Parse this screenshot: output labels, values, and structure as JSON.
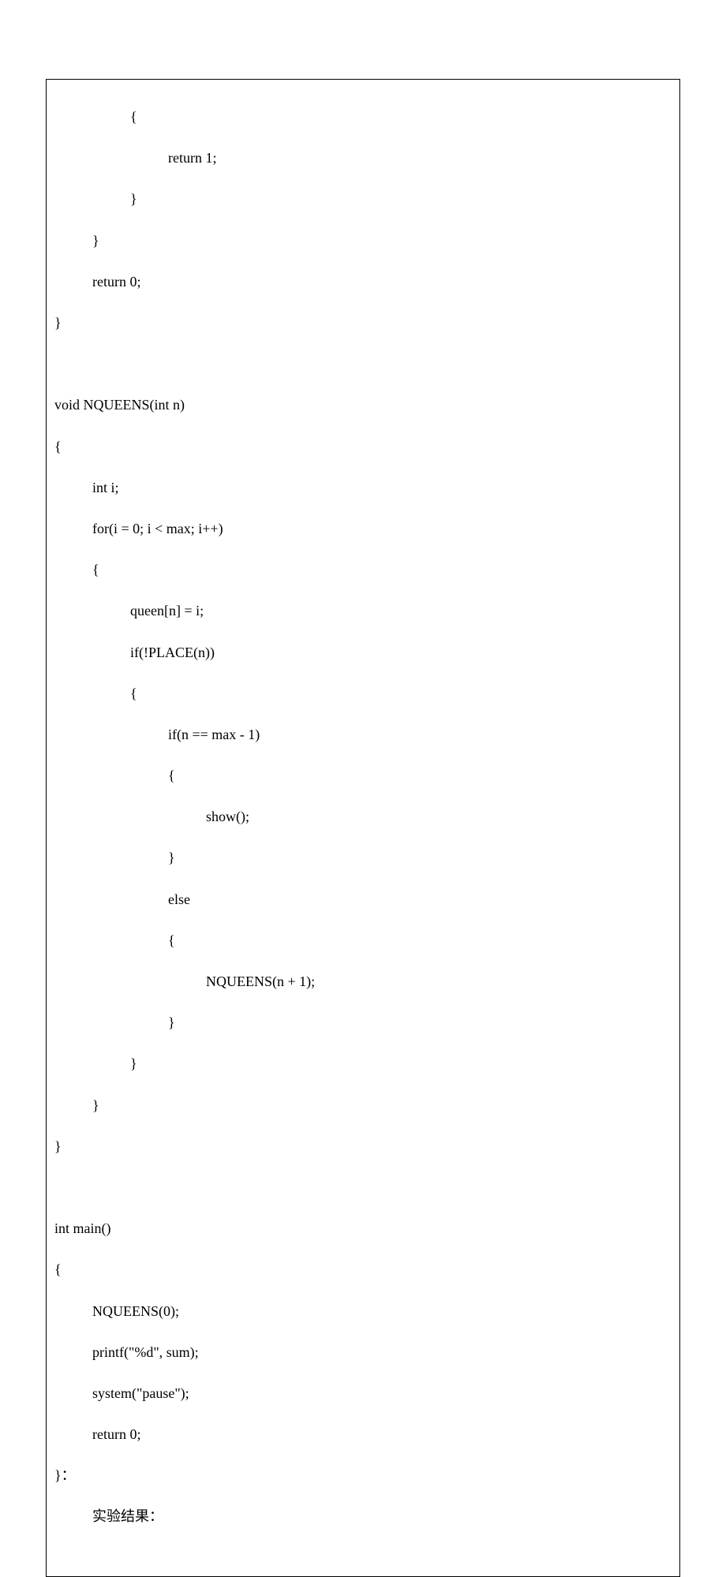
{
  "code": {
    "l1": "{",
    "l2": "return 1;",
    "l3": "}",
    "l4": "}",
    "l5": "return 0;",
    "l6": "}",
    "l7": "",
    "l8": "void NQUEENS(int n)",
    "l9": "{",
    "l10": "int i;",
    "l11": "for(i = 0; i < max; i++)",
    "l12": "{",
    "l13": "queen[n] = i;",
    "l14": "if(!PLACE(n))",
    "l15": "{",
    "l16": "if(n == max - 1)",
    "l17": "{",
    "l18": "show();",
    "l19": "}",
    "l20": "else",
    "l21": "{",
    "l22": "NQUEENS(n + 1);",
    "l23": "}",
    "l24": "}",
    "l25": "}",
    "l26": "}",
    "l27": "",
    "l28": "int main()",
    "l29": "{",
    "l30": "NQUEENS(0);",
    "l31": "printf(\"%d\", sum);",
    "l32": "system(\"pause\");",
    "l33": "return 0;",
    "l34": "}：",
    "l35": "实验结果："
  }
}
